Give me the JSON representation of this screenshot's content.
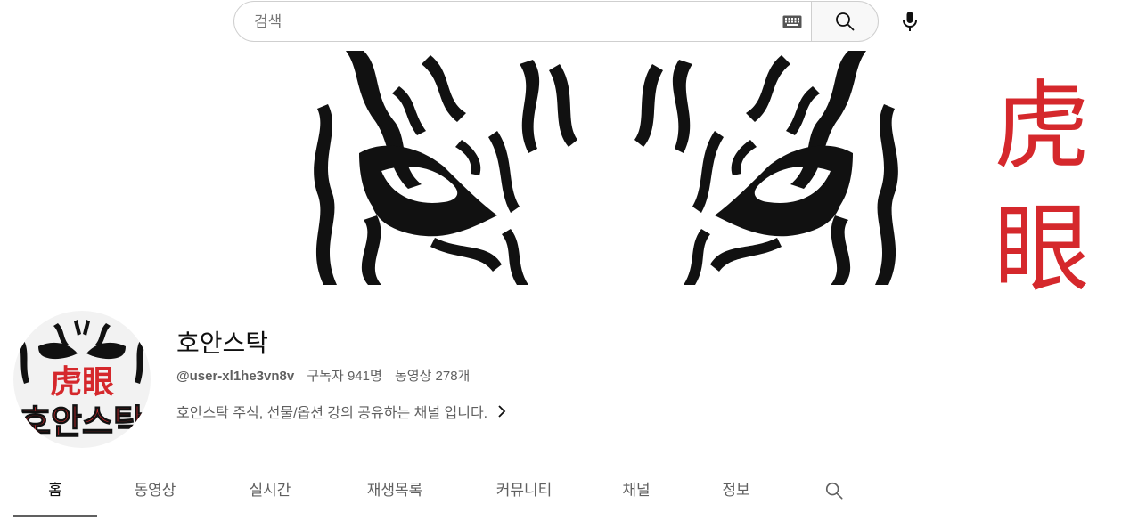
{
  "search": {
    "placeholder": "검색",
    "value": ""
  },
  "icons": {
    "keyboard": "keyboard-icon",
    "search": "search-icon",
    "mic": "microphone-icon",
    "chevron": "chevron-right-icon",
    "tab_search": "search-icon"
  },
  "banner": {
    "hanja_top": "虎",
    "hanja_bottom": "眼"
  },
  "avatar": {
    "logo_hanja": "虎眼",
    "logo_text": "호안스탁"
  },
  "channel": {
    "name": "호안스탁",
    "handle": "@user-xl1he3vn8v",
    "subscribers": "구독자 941명",
    "videos": "동영상 278개",
    "description": "호안스탁 주식, 선물/옵션 강의 공유하는 채널 입니다."
  },
  "tabs": [
    "홈",
    "동영상",
    "실시간",
    "재생목록",
    "커뮤니티",
    "채널",
    "정보"
  ],
  "active_tab": "홈",
  "colors": {
    "accent_red": "#d5282c",
    "text_secondary": "#606060"
  }
}
